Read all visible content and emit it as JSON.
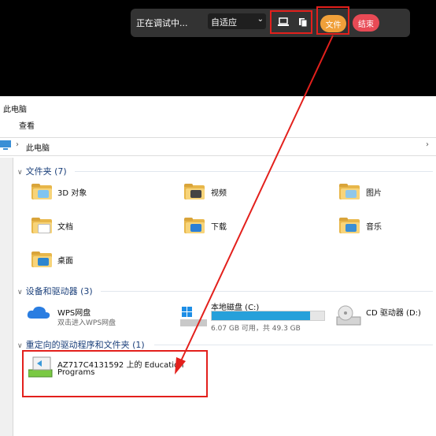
{
  "debug_bar": {
    "status_text": "正在调试中...",
    "mode_select": "自适应",
    "file_button": "文件",
    "end_button": "结束"
  },
  "explorer": {
    "window_title": "此电脑",
    "ribbon_tab": "查看",
    "breadcrumb": "此电脑",
    "folders_section": "文件夹 (7)",
    "folders": [
      "3D 对象",
      "视频",
      "图片",
      "文档",
      "下载",
      "音乐",
      "桌面"
    ],
    "devices_section": "设备和驱动器 (3)",
    "devices": {
      "wps_name": "WPS网盘",
      "wps_sub": "双击进入WPS网盘",
      "local_name": "本地磁盘 (C:)",
      "local_sub": "6.07 GB 可用，共 49.3 GB",
      "local_used_fraction": 0.877,
      "cd_name": "CD 驱动器 (D:)"
    },
    "redirected_section": "重定向的驱动程序和文件夹 (1)",
    "redirected_item_line1": "AZ717C4131592 上的 Education",
    "redirected_item_line2": "Programs"
  },
  "colors": {
    "highlight": "#e3201c",
    "file_button": "#f0a03a",
    "end_button": "#e84a55",
    "drive_bar": "#26a0da"
  }
}
